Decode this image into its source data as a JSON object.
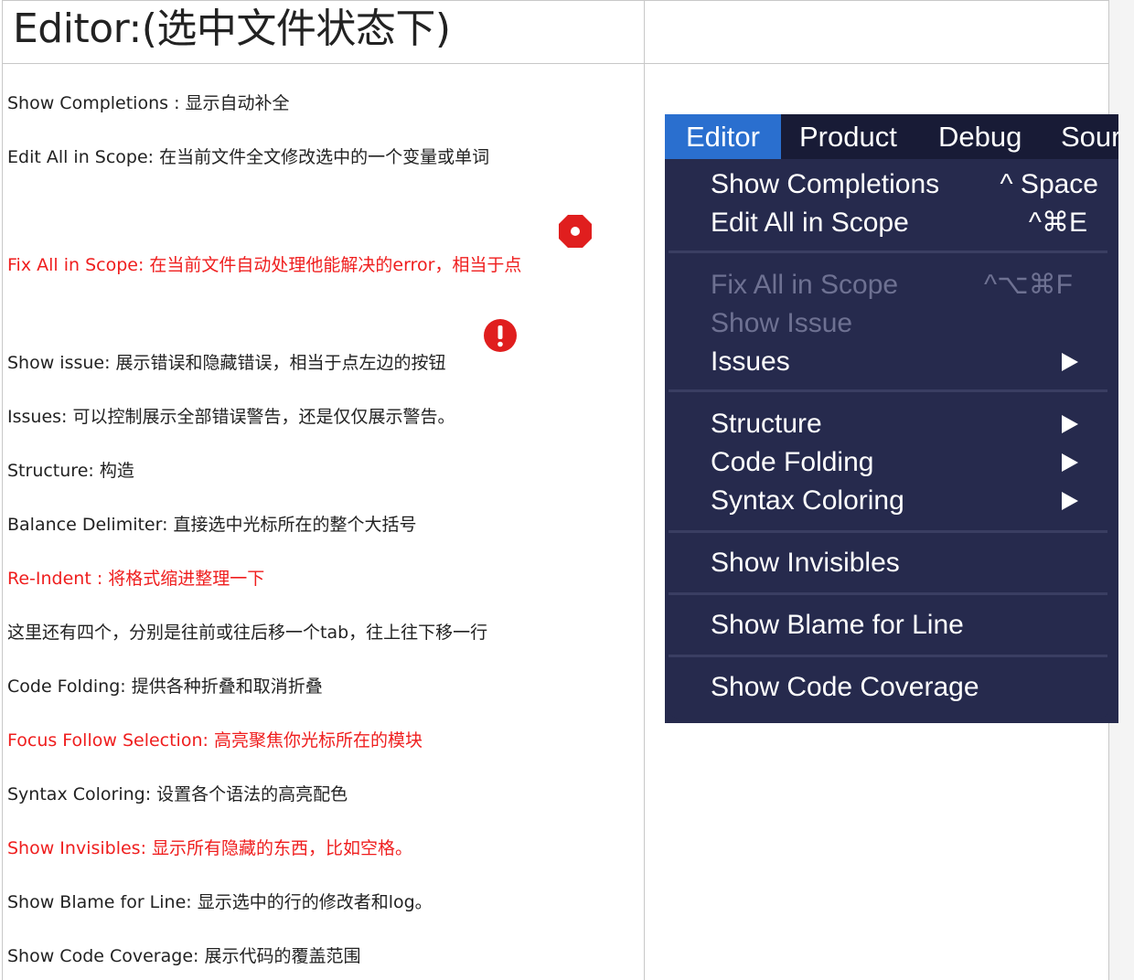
{
  "header": {
    "title": "Editor:(选中文件状态下)"
  },
  "descriptions": [
    {
      "text": "Show Completions : 显示自动补全",
      "red": false
    },
    {
      "text": "Edit All in Scope: 在当前文件全文修改选中的一个变量或单词",
      "red": false
    },
    {
      "text": "Fix All in Scope: 在当前文件自动处理他能解决的error，相当于点",
      "red": true
    },
    {
      "text": "Show issue: 展示错误和隐藏错误，相当于点左边的按钮",
      "red": false
    },
    {
      "text": "Issues: 可以控制展示全部错误警告，还是仅仅展示警告。",
      "red": false
    },
    {
      "text": "Structure: 构造",
      "red": false
    },
    {
      "text": "Balance Delimiter:  直接选中光标所在的整个大括号",
      "red": false
    },
    {
      "text": "Re-Indent : 将格式缩进整理一下",
      "red": true
    },
    {
      "text": "这里还有四个，分别是往前或往后移一个tab，往上往下移一行",
      "red": false
    },
    {
      "text": "Code Folding: 提供各种折叠和取消折叠",
      "red": false
    },
    {
      "text": "Focus Follow Selection:  高亮聚焦你光标所在的模块",
      "red": true
    },
    {
      "text": "Syntax Coloring: 设置各个语法的高亮配色",
      "red": false
    },
    {
      "text": "Show Invisibles: 显示所有隐藏的东西，比如空格。",
      "red": true
    },
    {
      "text": "Show Blame for Line: 显示选中的行的修改者和log。",
      "red": false
    },
    {
      "text": "Show Code Coverage: 展示代码的覆盖范围",
      "red": false
    }
  ],
  "icons": {
    "fix_icon": "octagon-error-icon",
    "issue_icon": "circle-exclamation-icon",
    "color": "#e01e1e"
  },
  "menu": {
    "bar": [
      "Editor",
      "Product",
      "Debug",
      "Sour"
    ],
    "items": [
      {
        "label": "Show Completions",
        "shortcut": "^ Space",
        "disabled": false
      },
      {
        "label": "Edit All in Scope",
        "shortcut": "^⌘E",
        "disabled": false
      },
      {
        "label": "Fix All in Scope",
        "shortcut": "^⌥⌘F",
        "disabled": true
      },
      {
        "label": "Show Issue",
        "shortcut": "",
        "disabled": true
      },
      {
        "label": "Issues",
        "shortcut": "",
        "disabled": false
      },
      {
        "label": "Structure",
        "shortcut": "",
        "disabled": false
      },
      {
        "label": "Code Folding",
        "shortcut": "",
        "disabled": false
      },
      {
        "label": "Syntax Coloring",
        "shortcut": "",
        "disabled": false
      },
      {
        "label": "Show Invisibles",
        "shortcut": "",
        "disabled": false
      },
      {
        "label": "Show Blame for Line",
        "shortcut": "",
        "disabled": false
      },
      {
        "label": "Show Code Coverage",
        "shortcut": "",
        "disabled": false
      }
    ],
    "colors": {
      "bar_bg": "#181b36",
      "active": "#2a6fcf",
      "panel_bg": "#262a4d",
      "disabled_text": "#6e7192"
    }
  }
}
